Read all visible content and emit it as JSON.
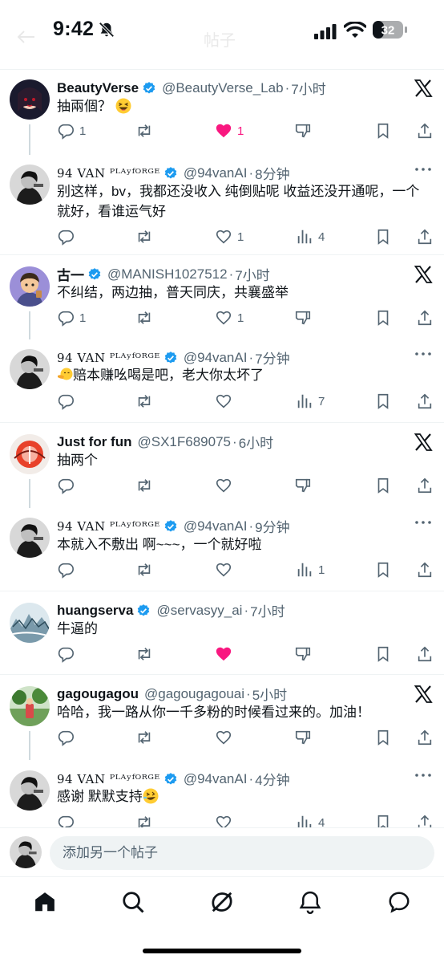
{
  "status_bar": {
    "time": "9:42",
    "battery": "32",
    "title_ghost": "帖子"
  },
  "icons": {
    "verified": "verified-badge-icon",
    "x": "x-logo-icon",
    "more": "more-icon"
  },
  "colors": {
    "accent": "#1d9bf0",
    "like": "#f91880",
    "muted": "#536471",
    "text": "#0f1419"
  },
  "replies": [
    {
      "name": "BeautyVerse",
      "verified": true,
      "handle": "@BeautyVerse_Lab",
      "time": "7小时",
      "text": "抽兩個？",
      "emoji": "grinning-squint-emoji",
      "reply_count": "1",
      "retweet_count": "",
      "like_count": "1",
      "liked": true,
      "views": null,
      "source_icon": "x"
    },
    {
      "name": "94 VAN ᴾᴸᴬʸᶠᴼᴿᴳᴱ",
      "verified": true,
      "handle": "@94vanAI",
      "time": "8分钟",
      "text": "别这样，bv，我都还没收入 纯倒贴呢 收益还没开通呢，一个就好，看谁运气好",
      "reply_count": "",
      "retweet_count": "",
      "like_count": "1",
      "liked": false,
      "views": "4",
      "source_icon": "more"
    },
    {
      "name": "古一",
      "verified": true,
      "handle": "@MANISH1027512",
      "time": "7小时",
      "text": "不纠结，两边抽，普天同庆，共襄盛举",
      "reply_count": "1",
      "retweet_count": "",
      "like_count": "1",
      "liked": false,
      "views": null,
      "source_icon": "x"
    },
    {
      "name": "94 VAN ᴾᴸᴬʸᶠᴼᴿᴳᴱ",
      "verified": true,
      "handle": "@94vanAI",
      "time": "7分钟",
      "text": "赔本赚吆喝是吧，老大你太坏了",
      "emoji_lead": "face-with-hand-emoji",
      "reply_count": "",
      "retweet_count": "",
      "like_count": "",
      "liked": false,
      "views": "7",
      "source_icon": "more"
    },
    {
      "name": "Just for fun",
      "verified": false,
      "handle": "@SX1F689075",
      "time": "6小时",
      "text": "抽两个",
      "reply_count": "",
      "retweet_count": "",
      "like_count": "",
      "liked": false,
      "views": null,
      "source_icon": "x"
    },
    {
      "name": "94 VAN ᴾᴸᴬʸᶠᴼᴿᴳᴱ",
      "verified": true,
      "handle": "@94vanAI",
      "time": "9分钟",
      "text": "本就入不敷出 啊~~~，一个就好啦",
      "reply_count": "",
      "retweet_count": "",
      "like_count": "",
      "liked": false,
      "views": "1",
      "source_icon": "more"
    },
    {
      "name": "huangserva",
      "verified": true,
      "handle": "@servasyy_ai",
      "time": "7小时",
      "text": "牛逼的",
      "reply_count": "",
      "retweet_count": "",
      "like_count": "",
      "liked": true,
      "views": null,
      "source_icon": "none"
    },
    {
      "name": "gagougagou",
      "verified": false,
      "handle": "@gagougagouai",
      "time": "5小时",
      "text": "哈哈，我一路从你一千多粉的时候看过来的。加油！",
      "reply_count": "",
      "retweet_count": "",
      "like_count": "",
      "liked": false,
      "views": null,
      "source_icon": "x"
    },
    {
      "name": "94 VAN ᴾᴸᴬʸᶠᴼᴿᴳᴱ",
      "verified": true,
      "handle": "@94vanAI",
      "time": "4分钟",
      "text": "感谢 默默支持",
      "emoji": "rofl-emoji",
      "reply_count": "",
      "retweet_count": "",
      "like_count": "",
      "liked": false,
      "views": "4",
      "source_icon": "more"
    }
  ],
  "compose": {
    "placeholder": "添加另一个帖子"
  },
  "tabbar": {
    "items": [
      "home-icon",
      "search-icon",
      "grok-icon",
      "notifications-icon",
      "messages-icon"
    ]
  }
}
